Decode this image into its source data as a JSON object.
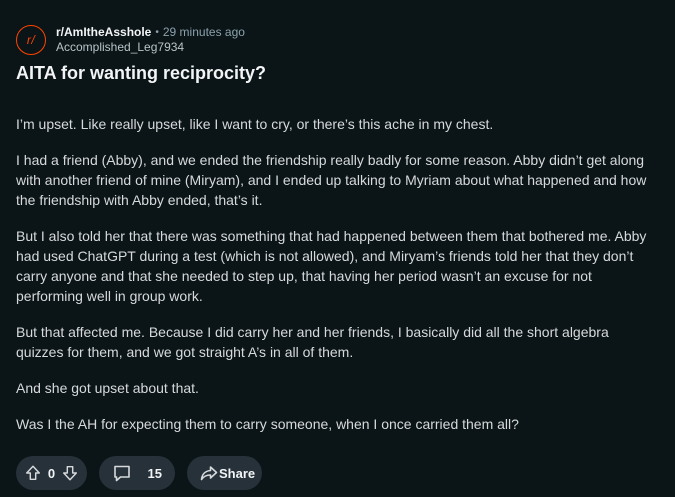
{
  "header": {
    "subreddit": "r/AmItheAsshole",
    "separator": "•",
    "time": "29 minutes ago",
    "author": "Accomplished_Leg7934",
    "avatar_text": "r/"
  },
  "post": {
    "title": "AITA for wanting reciprocity?",
    "paragraphs": [
      "I’m upset. Like really upset, like I want to cry, or there’s this ache in my chest.",
      "I had a friend (Abby), and we ended the friendship really badly for some reason. Abby didn’t get along with another friend of mine (Miryam), and I ended up talking to Myriam about what happened and how the friendship with Abby ended, that’s it.",
      "But I also told her that there was something that had happened between them that bothered me. Abby had used ChatGPT during a test (which is not allowed), and Miryam’s friends told her that they don’t carry anyone and that she needed to step up, that having her period wasn’t an excuse for not performing well in group work.",
      "But that affected me. Because I did carry her and her friends, I basically did all the short algebra quizzes for them, and we got straight A’s in all of them.",
      "And she got upset about that.",
      "Was I the AH for expecting them to carry someone, when I once carried them all?"
    ]
  },
  "actions": {
    "vote_count": "0",
    "comment_count": "15",
    "share_label": "Share"
  },
  "colors": {
    "background": "#0b1416",
    "pill": "#26313a",
    "accent": "#ff4500"
  },
  "icons": {
    "upvote": "upvote-icon",
    "downvote": "downvote-icon",
    "comment": "comment-icon",
    "share": "share-icon"
  }
}
